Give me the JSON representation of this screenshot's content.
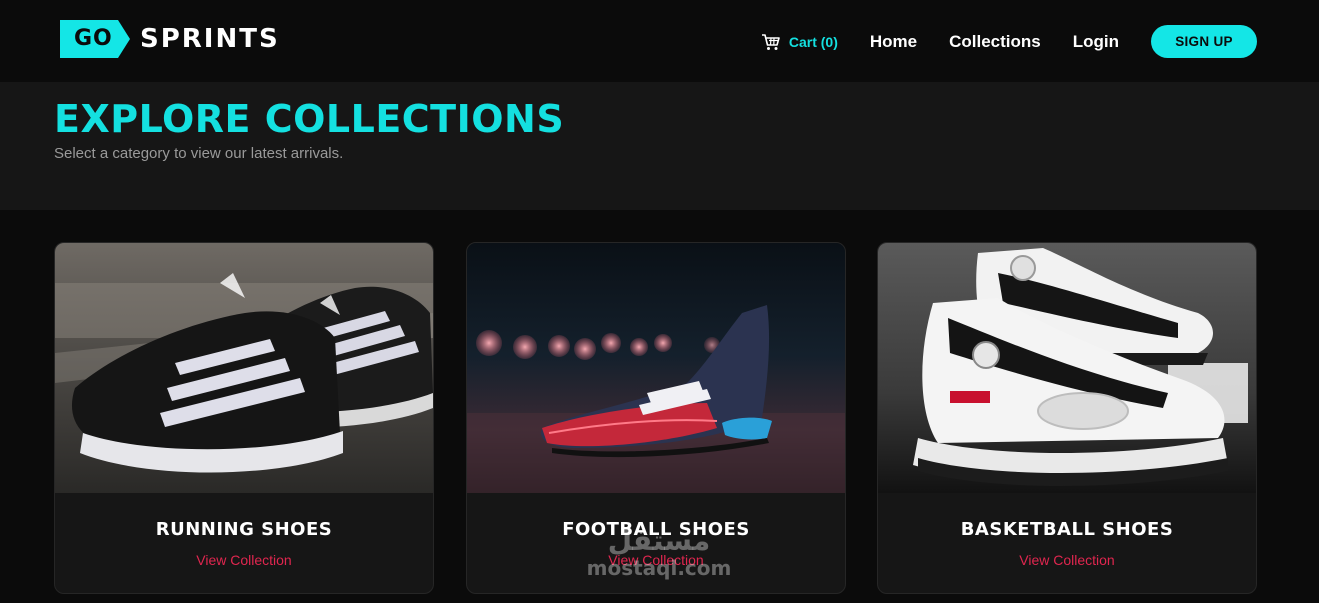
{
  "brand": {
    "logo_badge": "GO",
    "logo_text": "SPRINTS"
  },
  "nav": {
    "cart_label": "Cart (0)",
    "links": [
      "Home",
      "Collections",
      "Login"
    ],
    "signup_label": "SIGN UP"
  },
  "hero": {
    "title": "EXPLORE COLLECTIONS",
    "subtitle": "Select a category to view our latest arrivals."
  },
  "collections": [
    {
      "title": "RUNNING SHOES",
      "link": "View Collection",
      "image": "black-running-shoe-photo"
    },
    {
      "title": "FOOTBALL SHOES",
      "link": "View Collection",
      "image": "football-boot-photo"
    },
    {
      "title": "BASKETBALL SHOES",
      "link": "View Collection",
      "image": "white-basketball-shoe-photo"
    }
  ],
  "watermark": {
    "arabic": "مستقل",
    "latin": "mostaql.com"
  },
  "colors": {
    "accent": "#14e0e0",
    "link": "#e0264f",
    "background": "#0b0b0b",
    "panel": "#161616"
  }
}
